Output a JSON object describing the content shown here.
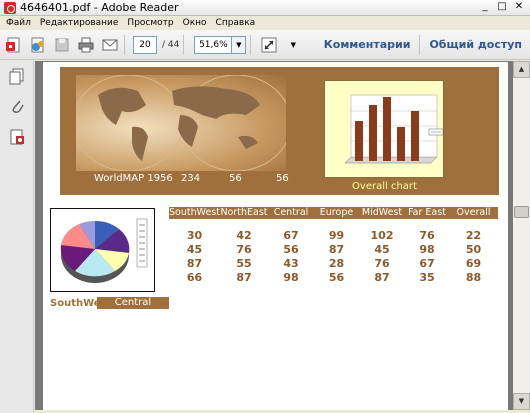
{
  "window": {
    "title": "4646401.pdf - Adobe Reader",
    "controls": {
      "minimize": "_",
      "maximize": "□",
      "close": "✕"
    }
  },
  "menu": [
    "Файл",
    "Редактирование",
    "Просмотр",
    "Окно",
    "Справка"
  ],
  "toolbar": {
    "page_current": "20",
    "page_total": "/ 44",
    "zoom": "51,6%",
    "zoom_arrow": "▼",
    "more_arrow": "▼",
    "comments_label": "Комментарии",
    "share_label": "Общий доступ",
    "icons": [
      "create-pdf-icon",
      "collaborate-icon",
      "save-icon",
      "print-icon",
      "email-icon",
      "fit-page-icon"
    ]
  },
  "sidebar": {
    "icons": [
      "pages-icon",
      "attachments-icon",
      "signatures-icon"
    ]
  },
  "scrollbar": {
    "up": "▲",
    "down": "▼"
  },
  "document": {
    "banner": {
      "map_label": "WorldMAP 1956",
      "values": [
        "234",
        "56",
        "56"
      ],
      "chart_caption": "Overall chart"
    },
    "grid": {
      "headers": [
        "SouthWest",
        "NorthEast",
        "Central",
        "Europe",
        "MidWest",
        "Far East",
        "Overall"
      ],
      "rows": [
        [
          "30",
          "42",
          "67",
          "99",
          "102",
          "76",
          "22"
        ],
        [
          "45",
          "76",
          "56",
          "87",
          "45",
          "98",
          "50"
        ],
        [
          "87",
          "55",
          "43",
          "28",
          "76",
          "67",
          "69"
        ],
        [
          "66",
          "87",
          "98",
          "56",
          "87",
          "35",
          "88"
        ]
      ]
    },
    "region_label": "SouthWest",
    "region_value": "Central",
    "colors": {
      "brown": "#a0703c",
      "value_text": "#8b5a2b",
      "chart_bg": "#ffffc6",
      "caption_yellow": "#ffff8c"
    }
  }
}
